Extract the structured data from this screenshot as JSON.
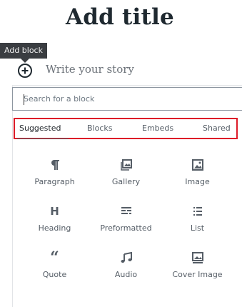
{
  "editor": {
    "title": "Add title",
    "placeholder": "Write your story"
  },
  "tooltip": {
    "label": "Add block"
  },
  "inserter": {
    "search_placeholder": "Search for a block",
    "tabs": [
      {
        "label": "Suggested",
        "active": true
      },
      {
        "label": "Blocks",
        "active": false
      },
      {
        "label": "Embeds",
        "active": false
      },
      {
        "label": "Shared",
        "active": false
      }
    ],
    "blocks": [
      {
        "label": "Paragraph",
        "icon": "paragraph-icon"
      },
      {
        "label": "Gallery",
        "icon": "gallery-icon"
      },
      {
        "label": "Image",
        "icon": "image-icon"
      },
      {
        "label": "Heading",
        "icon": "heading-icon"
      },
      {
        "label": "Preformatted",
        "icon": "preformatted-icon"
      },
      {
        "label": "List",
        "icon": "list-icon"
      },
      {
        "label": "Quote",
        "icon": "quote-icon"
      },
      {
        "label": "Audio",
        "icon": "audio-icon"
      },
      {
        "label": "Cover Image",
        "icon": "cover-image-icon"
      }
    ]
  },
  "colors": {
    "highlight_border": "#dd1b28",
    "tooltip_bg": "#3a3d41",
    "text": "#555d66"
  }
}
